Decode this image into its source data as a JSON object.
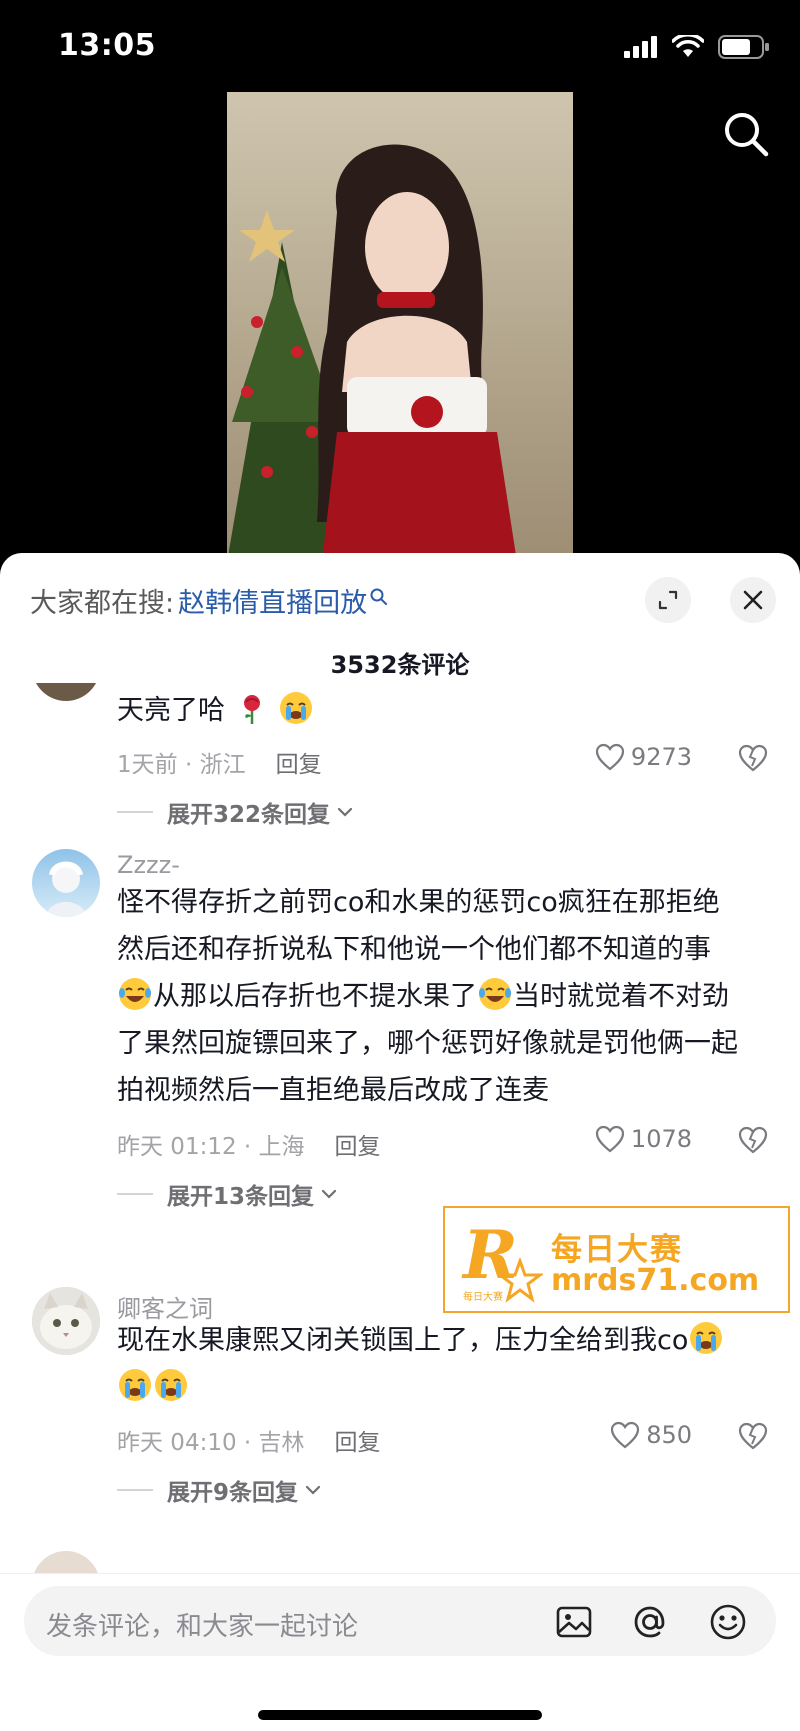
{
  "status": {
    "time": "13:05"
  },
  "header": {
    "search_prefix": "大家都在搜:",
    "search_link": "赵韩倩直播回放",
    "comment_count": "3532条评论"
  },
  "comments": [
    {
      "username": "",
      "text": "天亮了哈",
      "time_location": "1天前 · 浙江",
      "reply": "回复",
      "likes": "9273",
      "expand": "展开322条回复"
    },
    {
      "username": "Zzzz-",
      "text_lines": [
        "怪不得存折之前罚co和水果的惩罚co疯狂在那拒绝",
        "然后还和存折说私下和他说一个他们都不知道的事",
        "从那以后存折也不提水果了",
        "当时就觉着不对劲",
        "了果然回旋镖回来了，哪个惩罚好像就是罚他俩一起",
        "拍视频然后一直拒绝最后改成了连麦"
      ],
      "time_location": "昨天 01:12 · 上海",
      "reply": "回复",
      "likes": "1078",
      "expand": "展开13条回复"
    },
    {
      "username": "卿客之词",
      "text": "现在水果康熙又闭关锁国上了，压力全给到我co",
      "time_location": "昨天 04:10 · 吉林",
      "reply": "回复",
      "likes": "850",
      "expand": "展开9条回复"
    }
  ],
  "watermark": {
    "letter": "R",
    "small": "每日大赛",
    "line1": "每日大赛",
    "line2": "mrds71.com"
  },
  "input": {
    "placeholder": "发条评论，和大家一起讨论"
  },
  "icons": [
    "signal-icon",
    "wifi-icon",
    "battery-icon",
    "search-icon",
    "expand-icon",
    "close-icon",
    "heart-icon",
    "broken-heart-icon",
    "chevron-down-icon",
    "image-icon",
    "at-icon",
    "emoji-icon"
  ]
}
